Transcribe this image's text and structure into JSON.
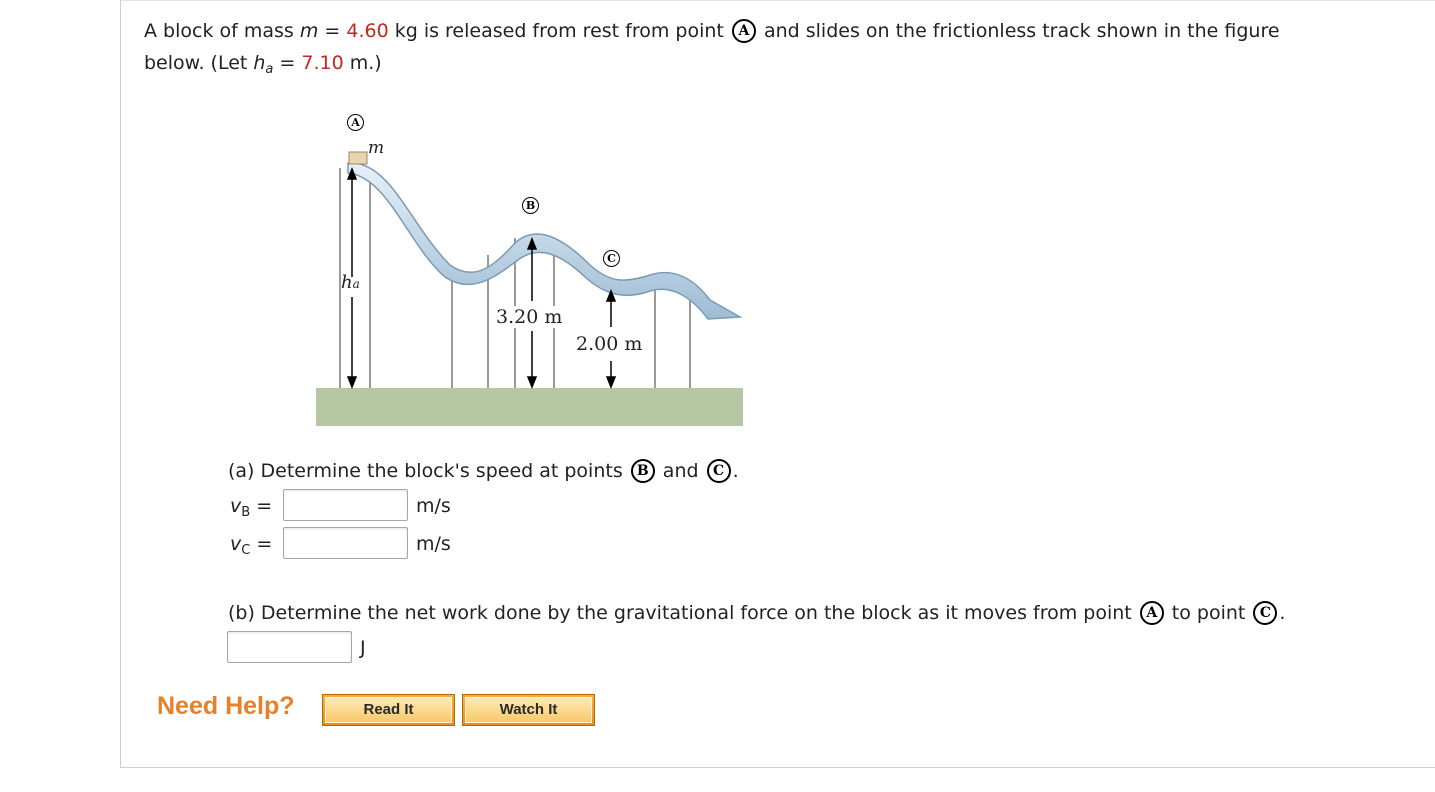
{
  "problem": {
    "intro_a": "A block of mass ",
    "m_sym": "m",
    "eq": " = ",
    "mass": "4.60",
    "intro_b": " kg is released from rest from point ",
    "point_a": "A",
    "intro_c": " and slides on the frictionless track shown in the figure",
    "line2_a": "below. (Let ",
    "h_sym": "h",
    "h_sub": "a",
    "eq2": " = ",
    "height": "7.10",
    "line2_b": " m.)"
  },
  "figure": {
    "label_A": "A",
    "label_B": "B",
    "label_C": "C",
    "mass_label": "m",
    "ha_label": "h",
    "ha_sub": "a",
    "height_B": "3.20 m",
    "height_C": "2.00 m",
    "colors": {
      "track": "#c6dcec",
      "track_edge": "#7a9bb5",
      "ground": "#b5c7a3",
      "block": "#e8d5b0"
    }
  },
  "part_a": {
    "question_a": "(a) Determine the block's speed at points ",
    "point_b": "B",
    "and": " and ",
    "point_c": "C",
    "period": ".",
    "vb_label": "v",
    "vb_sub": "B",
    "vc_label": "v",
    "vc_sub": "C",
    "eq": " =",
    "vb_value": "",
    "vc_value": "",
    "unit": "m/s"
  },
  "part_b": {
    "question_a": "(b) Determine the net work done by the gravitational force on the block as it moves from point ",
    "point_a": "A",
    "to_point": " to point ",
    "point_c": "C",
    "period": ".",
    "value": "",
    "unit": "J"
  },
  "help": {
    "label": "Need Help?",
    "read_it": "Read It",
    "watch_it": "Watch It"
  }
}
